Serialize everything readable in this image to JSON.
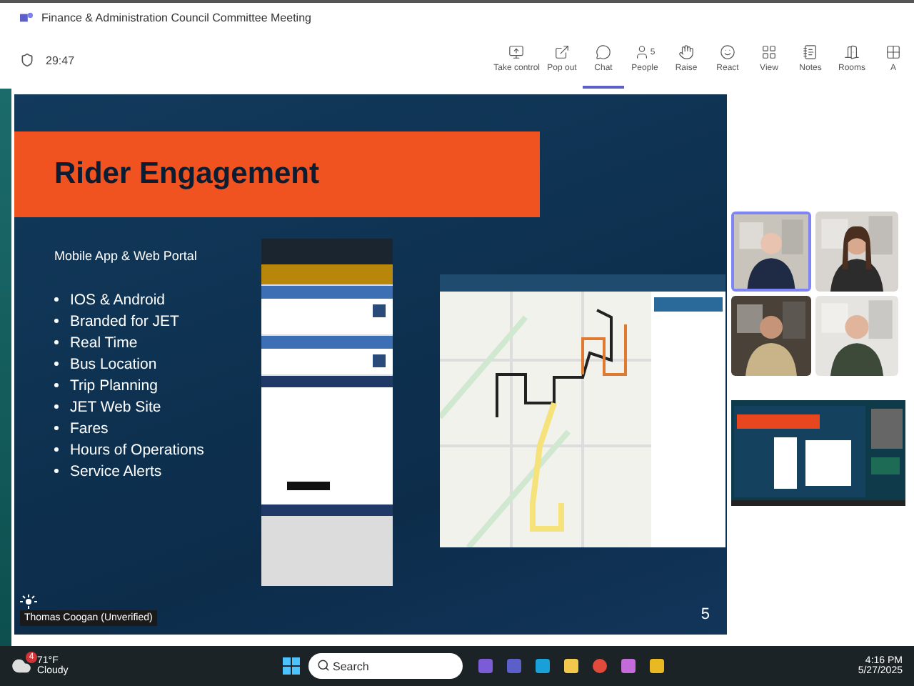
{
  "window": {
    "title": "Finance & Administration Council Committee Meeting"
  },
  "timer": "29:47",
  "toolbar": [
    {
      "kind": "share",
      "label": "Take control",
      "selected": false
    },
    {
      "kind": "popout",
      "label": "Pop out",
      "selected": false
    },
    {
      "kind": "chat",
      "label": "Chat",
      "selected": true
    },
    {
      "kind": "people",
      "label": "People",
      "count": "5",
      "selected": false
    },
    {
      "kind": "raise",
      "label": "Raise",
      "selected": false
    },
    {
      "kind": "react",
      "label": "React",
      "selected": false
    },
    {
      "kind": "view",
      "label": "View",
      "selected": false
    },
    {
      "kind": "notes",
      "label": "Notes",
      "selected": false
    },
    {
      "kind": "rooms",
      "label": "Rooms",
      "selected": false
    },
    {
      "kind": "apps",
      "label": "A",
      "selected": false
    }
  ],
  "slide": {
    "title": "Rider Engagement",
    "subtitle": "Mobile App & Web Portal",
    "bullets": [
      "IOS & Android",
      "Branded for JET",
      "Real Time",
      "Bus Location",
      "Trip Planning",
      "JET Web Site",
      "Fares",
      "Hours of Operations",
      "Service Alerts"
    ],
    "page": "5"
  },
  "presenter": {
    "name": "Thomas Coogan (Unverified)"
  },
  "participants": [
    {
      "kind": "picture",
      "speaking": true
    },
    {
      "kind": "picture",
      "speaking": false
    },
    {
      "kind": "picture",
      "speaking": false
    },
    {
      "kind": "picture",
      "speaking": false
    }
  ],
  "taskbar": {
    "weather": {
      "temp": "71°F",
      "condition": "Cloudy",
      "badge": "4"
    },
    "search": {
      "placeholder": "Search"
    },
    "time": "4:16 PM",
    "date": "5/27/2025"
  }
}
